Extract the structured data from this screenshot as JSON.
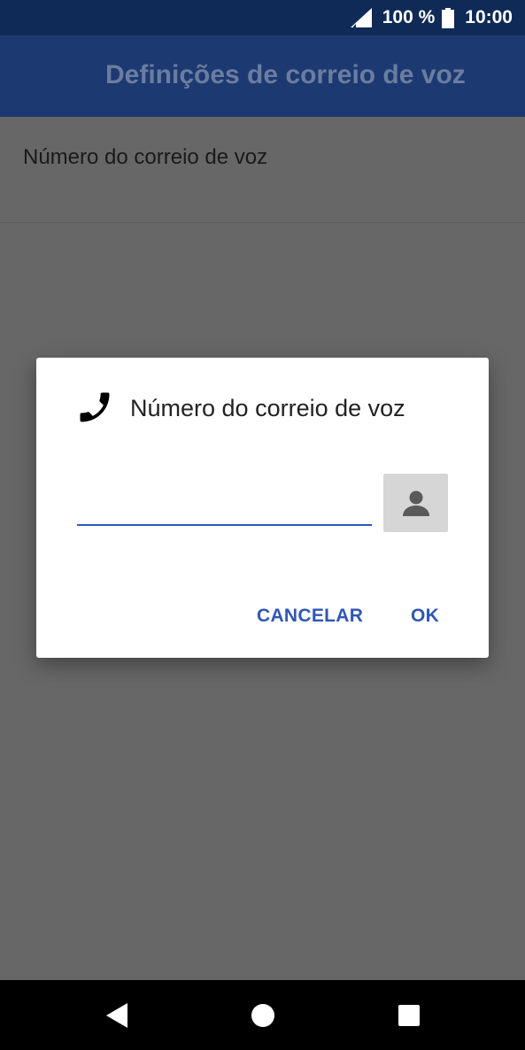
{
  "status_bar": {
    "battery_percent": "100 %",
    "time": "10:00",
    "icons": [
      "signal-icon",
      "battery-icon"
    ]
  },
  "app_bar": {
    "title": "Definições de correio de voz"
  },
  "settings": {
    "items": [
      {
        "label": "Número do correio de voz"
      }
    ]
  },
  "dialog": {
    "title": "Número do correio de voz",
    "icon": "phone-icon",
    "input_value": "",
    "contact_icon": "person-icon",
    "cancel_label": "CANCELAR",
    "ok_label": "OK"
  },
  "nav_bar": {
    "icons": [
      "back-icon",
      "home-icon",
      "recents-icon"
    ]
  },
  "colors": {
    "status_bar": "#0f2a56",
    "app_bar": "#1c3971",
    "accent": "#2f57b5",
    "scrim_background": "#676767"
  }
}
